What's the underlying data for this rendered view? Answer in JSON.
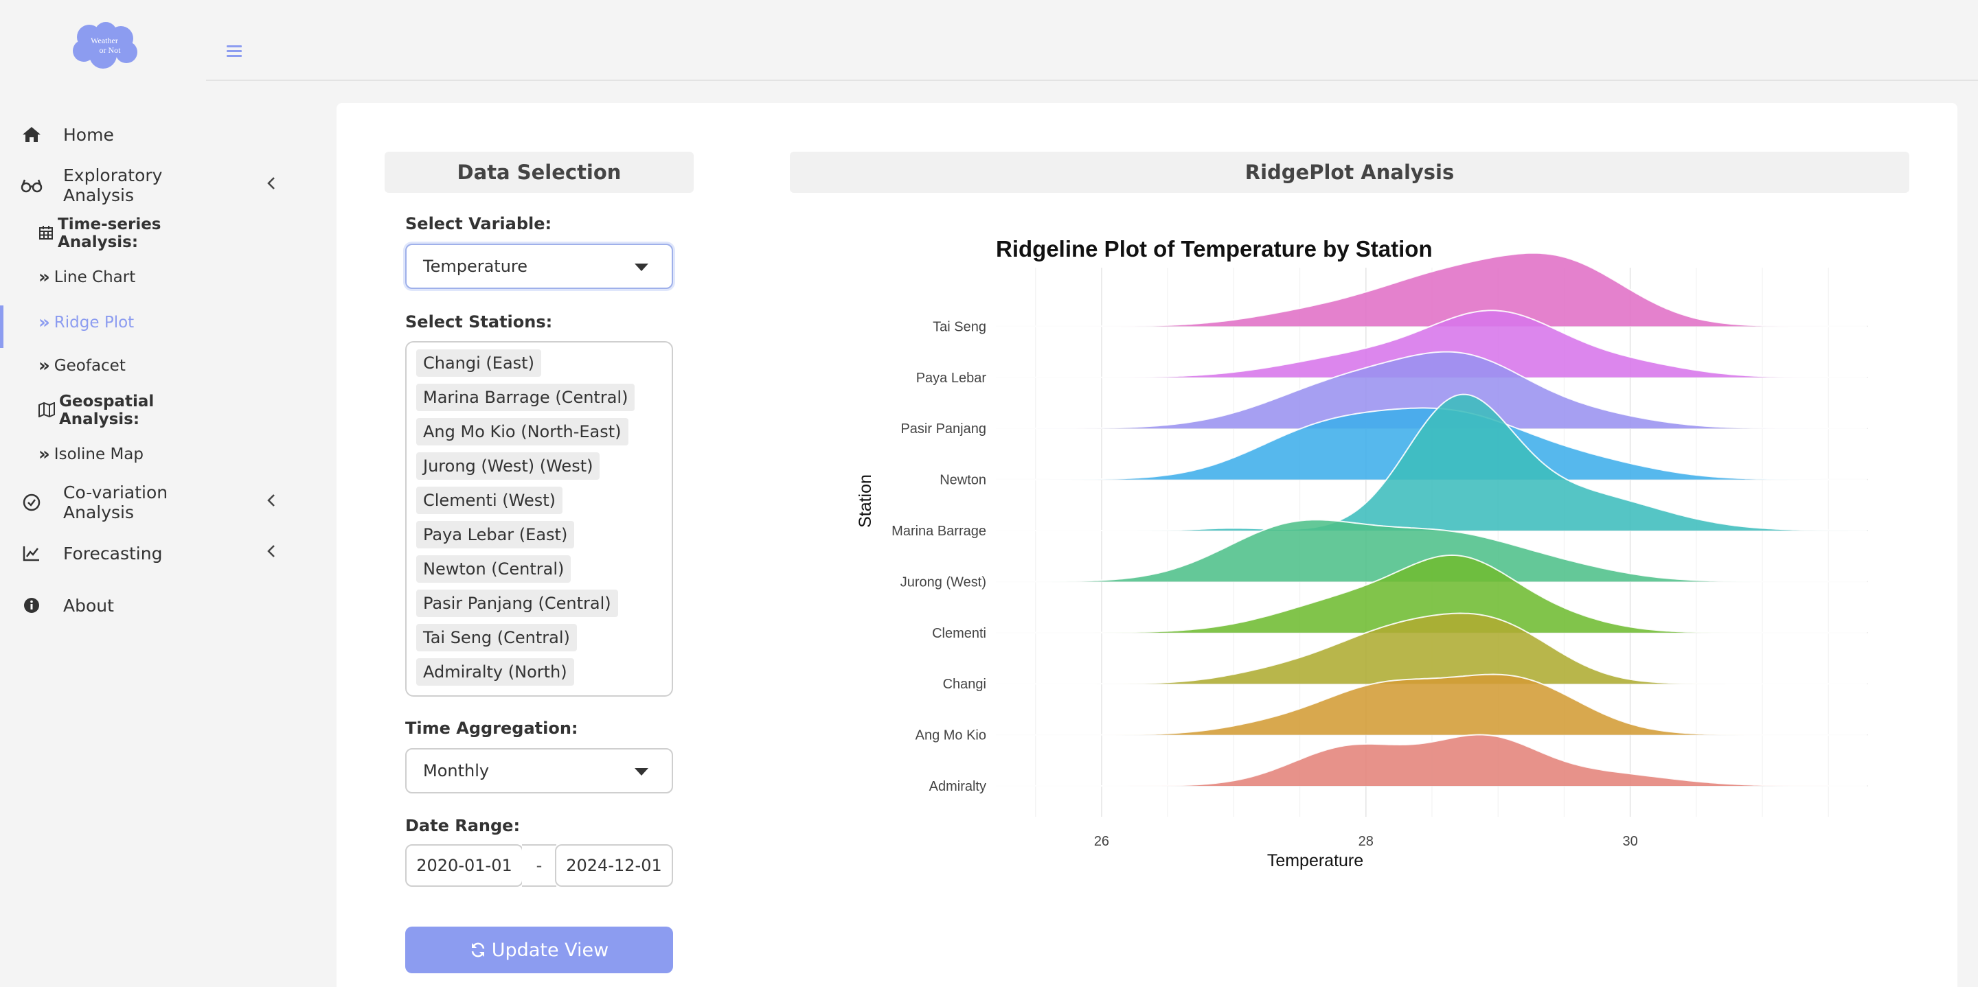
{
  "logo": {
    "text_line1": "Weather",
    "text_line2": "or Not"
  },
  "sidebar": {
    "items": [
      {
        "label": "Home",
        "icon": "home-icon"
      },
      {
        "label": "Exploratory Analysis",
        "icon": "glasses-icon"
      },
      {
        "label": "Co-variation Analysis",
        "icon": "check-circle-icon"
      },
      {
        "label": "Forecasting",
        "icon": "line-chart-icon"
      },
      {
        "label": "About",
        "icon": "info-icon"
      }
    ],
    "exploratory": {
      "timeseries_heading": "Time-series Analysis:",
      "line_chart": "Line Chart",
      "ridge_plot": "Ridge Plot",
      "geofacet": "Geofacet",
      "geospatial_heading": "Geospatial Analysis:",
      "isoline_map": "Isoline Map"
    }
  },
  "data_selection": {
    "title": "Data Selection",
    "variable_label": "Select Variable:",
    "variable_value": "Temperature",
    "stations_label": "Select Stations:",
    "stations": [
      "Changi (East)",
      "Marina Barrage (Central)",
      "Ang Mo Kio (North-East)",
      "Jurong (West) (West)",
      "Clementi (West)",
      "Paya Lebar (East)",
      "Newton (Central)",
      "Pasir Panjang (Central)",
      "Tai Seng (Central)",
      "Admiralty (North)"
    ],
    "aggregation_label": "Time Aggregation:",
    "aggregation_value": "Monthly",
    "date_label": "Date Range:",
    "date_start": "2020-01-01",
    "date_sep": "-",
    "date_end": "2024-12-01",
    "update_button": "Update View"
  },
  "ridge_panel": {
    "title": "RidgePlot Analysis"
  },
  "chart_data": {
    "type": "ridgeline",
    "title": "Ridgeline Plot of Temperature by Station",
    "xlabel": "Temperature",
    "ylabel": "Station",
    "xlim": [
      25.2,
      31.8
    ],
    "x_ticks": [
      26,
      28,
      30
    ],
    "grid": true,
    "legend": "none",
    "series": [
      {
        "name": "Tai Seng",
        "color": "#E06FC6",
        "peaks": [
          [
            28.6,
            0.75,
            0.55
          ],
          [
            29.5,
            0.95,
            0.5
          ],
          [
            27.6,
            0.2,
            0.5
          ]
        ]
      },
      {
        "name": "Paya Lebar",
        "color": "#D775EA",
        "peaks": [
          [
            29.0,
            1.0,
            0.5
          ],
          [
            28.0,
            0.35,
            0.6
          ],
          [
            30.0,
            0.2,
            0.45
          ]
        ]
      },
      {
        "name": "Pasir Panjang",
        "color": "#9A92F0",
        "peaks": [
          [
            28.0,
            0.85,
            0.65
          ],
          [
            28.8,
            0.75,
            0.45
          ],
          [
            29.6,
            0.25,
            0.5
          ]
        ]
      },
      {
        "name": "Newton",
        "color": "#3FAEEA",
        "peaks": [
          [
            27.7,
            0.8,
            0.55
          ],
          [
            28.7,
            0.95,
            0.55
          ],
          [
            29.7,
            0.25,
            0.5
          ]
        ]
      },
      {
        "name": "Marina Barrage",
        "color": "#3DBDBD",
        "peaks": [
          [
            28.7,
            2.05,
            0.4
          ],
          [
            29.6,
            0.6,
            0.6
          ],
          [
            27.0,
            0.04,
            0.25
          ]
        ]
      },
      {
        "name": "Jurong (West)",
        "color": "#4EC08A",
        "peaks": [
          [
            27.5,
            0.95,
            0.55
          ],
          [
            28.6,
            0.65,
            0.5
          ],
          [
            29.4,
            0.25,
            0.5
          ]
        ]
      },
      {
        "name": "Clementi",
        "color": "#6FBC32",
        "peaks": [
          [
            28.0,
            0.6,
            0.6
          ],
          [
            28.7,
            0.85,
            0.4
          ],
          [
            29.3,
            0.3,
            0.45
          ]
        ]
      },
      {
        "name": "Changi",
        "color": "#AEAC32",
        "peaks": [
          [
            28.2,
            0.8,
            0.5
          ],
          [
            29.0,
            0.85,
            0.45
          ],
          [
            27.3,
            0.15,
            0.4
          ]
        ]
      },
      {
        "name": "Ang Mo Kio",
        "color": "#D39C35",
        "peaks": [
          [
            28.1,
            0.72,
            0.45
          ],
          [
            29.1,
            0.92,
            0.5
          ],
          [
            27.3,
            0.15,
            0.4
          ]
        ]
      },
      {
        "name": "Admiralty",
        "color": "#E4837A",
        "peaks": [
          [
            27.9,
            0.65,
            0.45
          ],
          [
            28.9,
            0.75,
            0.4
          ],
          [
            29.8,
            0.2,
            0.5
          ]
        ]
      }
    ]
  }
}
